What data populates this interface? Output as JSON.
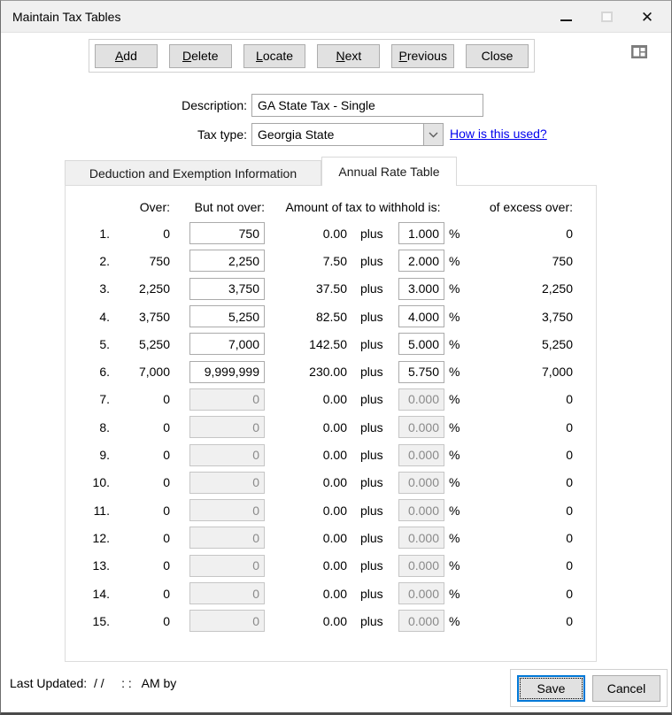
{
  "window": {
    "title": "Maintain Tax Tables"
  },
  "toolbar": {
    "buttons": [
      {
        "u": "A",
        "rest": "dd"
      },
      {
        "u": "D",
        "rest": "elete"
      },
      {
        "u": "L",
        "rest": "ocate"
      },
      {
        "u": "N",
        "rest": "ext"
      },
      {
        "u": "P",
        "rest": "revious"
      },
      {
        "u": "",
        "rest": "Close"
      }
    ]
  },
  "form": {
    "description_label": "Description:",
    "description_value": "GA State Tax - Single",
    "tax_type_label": "Tax type:",
    "tax_type_value": "Georgia State",
    "help_link": "How is this used?"
  },
  "tabs": [
    {
      "label": "Deduction and Exemption Information",
      "active": false
    },
    {
      "label": "Annual Rate Table",
      "active": true
    }
  ],
  "table": {
    "headers": {
      "over": "Over:",
      "but_not_over": "But not over:",
      "amount": "Amount of tax to withhold is:",
      "excess": "of excess over:"
    },
    "plus_label": "plus",
    "percent_label": "%",
    "rows": [
      {
        "n": "1.",
        "over": "0",
        "but_not_over": "750",
        "amount": "0.00",
        "rate": "1.000",
        "excess": "0",
        "enabled": true
      },
      {
        "n": "2.",
        "over": "750",
        "but_not_over": "2,250",
        "amount": "7.50",
        "rate": "2.000",
        "excess": "750",
        "enabled": true
      },
      {
        "n": "3.",
        "over": "2,250",
        "but_not_over": "3,750",
        "amount": "37.50",
        "rate": "3.000",
        "excess": "2,250",
        "enabled": true
      },
      {
        "n": "4.",
        "over": "3,750",
        "but_not_over": "5,250",
        "amount": "82.50",
        "rate": "4.000",
        "excess": "3,750",
        "enabled": true
      },
      {
        "n": "5.",
        "over": "5,250",
        "but_not_over": "7,000",
        "amount": "142.50",
        "rate": "5.000",
        "excess": "5,250",
        "enabled": true
      },
      {
        "n": "6.",
        "over": "7,000",
        "but_not_over": "9,999,999",
        "amount": "230.00",
        "rate": "5.750",
        "excess": "7,000",
        "enabled": true
      },
      {
        "n": "7.",
        "over": "0",
        "but_not_over": "0",
        "amount": "0.00",
        "rate": "0.000",
        "excess": "0",
        "enabled": false
      },
      {
        "n": "8.",
        "over": "0",
        "but_not_over": "0",
        "amount": "0.00",
        "rate": "0.000",
        "excess": "0",
        "enabled": false
      },
      {
        "n": "9.",
        "over": "0",
        "but_not_over": "0",
        "amount": "0.00",
        "rate": "0.000",
        "excess": "0",
        "enabled": false
      },
      {
        "n": "10.",
        "over": "0",
        "but_not_over": "0",
        "amount": "0.00",
        "rate": "0.000",
        "excess": "0",
        "enabled": false
      },
      {
        "n": "11.",
        "over": "0",
        "but_not_over": "0",
        "amount": "0.00",
        "rate": "0.000",
        "excess": "0",
        "enabled": false
      },
      {
        "n": "12.",
        "over": "0",
        "but_not_over": "0",
        "amount": "0.00",
        "rate": "0.000",
        "excess": "0",
        "enabled": false
      },
      {
        "n": "13.",
        "over": "0",
        "but_not_over": "0",
        "amount": "0.00",
        "rate": "0.000",
        "excess": "0",
        "enabled": false
      },
      {
        "n": "14.",
        "over": "0",
        "but_not_over": "0",
        "amount": "0.00",
        "rate": "0.000",
        "excess": "0",
        "enabled": false
      },
      {
        "n": "15.",
        "over": "0",
        "but_not_over": "0",
        "amount": "0.00",
        "rate": "0.000",
        "excess": "0",
        "enabled": false
      }
    ]
  },
  "footer": {
    "last_updated": "Last Updated:  / /     : :   AM by",
    "save_label": "Save",
    "cancel_label": "Cancel"
  },
  "colors": {
    "link_blue": "#0000EE",
    "focus_blue": "#0078d7",
    "button_gray": "#e1e1e1",
    "disabled_field_gray": "#f0f0f0"
  }
}
